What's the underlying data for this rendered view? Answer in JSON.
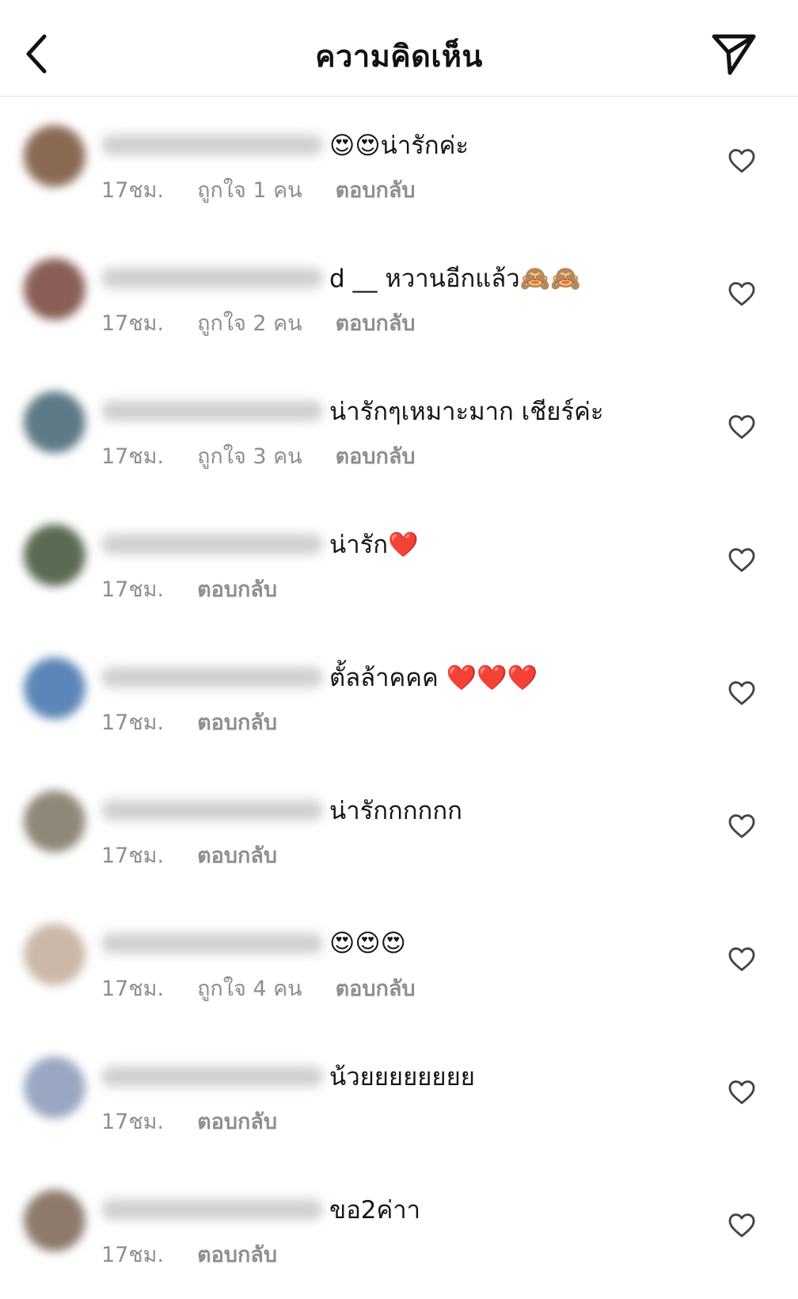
{
  "header": {
    "title": "ความคิดเห็น"
  },
  "comments": [
    {
      "text": "😍😍น่ารักค่ะ",
      "time": "17ชม.",
      "likes": "ถูกใจ 1 คน",
      "reply": "ตอบกลับ"
    },
    {
      "text": "d __ หวานอีกแล้ว🙈🙈",
      "time": "17ชม.",
      "likes": "ถูกใจ 2 คน",
      "reply": "ตอบกลับ"
    },
    {
      "text": "น่ารักๆเหมาะมาก เชียร์ค่ะ",
      "time": "17ชม.",
      "likes": "ถูกใจ 3 คน",
      "reply": "ตอบกลับ"
    },
    {
      "text": "น่ารัก❤️",
      "time": "17ชม.",
      "likes": "",
      "reply": "ตอบกลับ"
    },
    {
      "text": "ตั้ลล้าคคค ❤️❤️❤️",
      "time": "17ชม.",
      "likes": "",
      "reply": "ตอบกลับ"
    },
    {
      "text": "น่ารักกกกกก",
      "time": "17ชม.",
      "likes": "",
      "reply": "ตอบกลับ"
    },
    {
      "text": "😍😍😍",
      "time": "17ชม.",
      "likes": "ถูกใจ 4 คน",
      "reply": "ตอบกลับ"
    },
    {
      "text": "น้วยยยยยยยย",
      "time": "17ชม.",
      "likes": "",
      "reply": "ตอบกลับ"
    },
    {
      "text": "ขอ2ค่าา",
      "time": "17ชม.",
      "likes": "",
      "reply": "ตอบกลับ"
    }
  ],
  "icons": {
    "back": "chevron-left-icon",
    "send": "paper-plane-icon",
    "like": "heart-outline-icon"
  },
  "colors": {
    "text": "#151515",
    "meta": "#8e8e8e",
    "divider": "#e3e3e3"
  }
}
